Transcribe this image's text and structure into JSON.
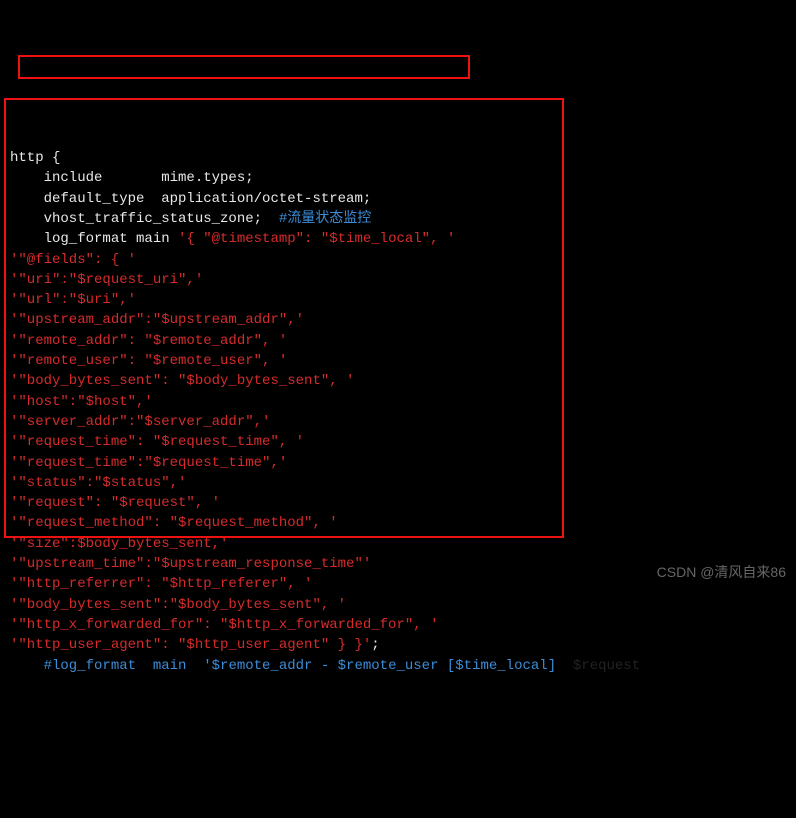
{
  "config": {
    "line1": "http {",
    "line2": "    include       mime.types;",
    "line3": "    default_type  application/octet-stream;",
    "line4_directive": "    vhost_traffic_status_zone;",
    "line4_comment": "  #流量状态监控",
    "blank": "",
    "log_start": "    log_format main ",
    "log_start_q": "'{ \"@timestamp\": \"$time_local\", '",
    "logs": [
      "'\"@fields\": { '",
      "'\"uri\":\"$request_uri\",'",
      "'\"url\":\"$uri\",'",
      "'\"upstream_addr\":\"$upstream_addr\",'",
      "'\"remote_addr\": \"$remote_addr\", '",
      "'\"remote_user\": \"$remote_user\", '",
      "'\"body_bytes_sent\": \"$body_bytes_sent\", '",
      "'\"host\":\"$host\",'",
      "'\"server_addr\":\"$server_addr\",'",
      "'\"request_time\": \"$request_time\", '",
      "'\"request_time\":\"$request_time\",'",
      "'\"status\":\"$status\",'",
      "'\"request\": \"$request\", '",
      "'\"request_method\": \"$request_method\", '",
      "'\"size\":$body_bytes_sent,'",
      "'\"upstream_time\":\"$upstream_response_time\"'",
      "'\"http_referrer\": \"$http_referer\", '",
      "'\"body_bytes_sent\":\"$body_bytes_sent\", '",
      "'\"http_x_forwarded_for\": \"$http_x_forwarded_for\", '"
    ],
    "log_last_red": "'\"http_user_agent\": \"$http_user_agent\" } }'",
    "log_last_white": ";",
    "footer_white_a": "    #log_format  main  ",
    "footer_blue": "'$remote_addr - $remote_user [$time_local]",
    "footer_hidden": "  $request "
  },
  "watermark": "CSDN @清风自来86"
}
